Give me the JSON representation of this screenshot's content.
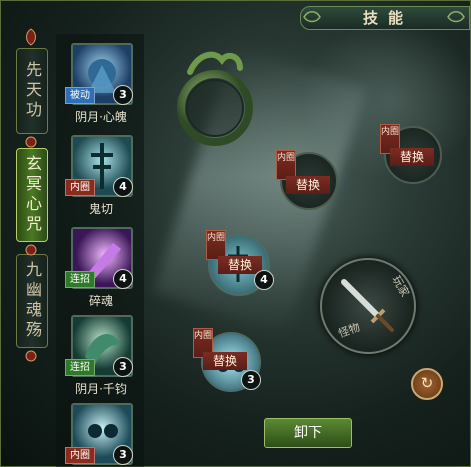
{
  "panel": {
    "title": "技能"
  },
  "tabs": [
    {
      "label": "先天功",
      "active": false
    },
    {
      "label": "玄冥心咒",
      "active": true
    },
    {
      "label": "九幽魂殇",
      "active": false
    }
  ],
  "skills": [
    {
      "name": "阴月·心魄",
      "tag": "被动",
      "tag_color": "blue",
      "level": "3",
      "art_color": "#3a7aa8"
    },
    {
      "name": "鬼切",
      "tag": "内圈",
      "tag_color": "red",
      "level": "4",
      "art_color": "#4b8e98"
    },
    {
      "name": "碎魂",
      "tag": "连招",
      "tag_color": "green",
      "level": "4",
      "art_color": "#7b3aa0"
    },
    {
      "name": "阴月·千钧",
      "tag": "连招",
      "tag_color": "green",
      "level": "3",
      "art_color": "#2f7a6e"
    },
    {
      "name": "",
      "tag": "内圈",
      "tag_color": "red",
      "level": "3",
      "art_color": "#3b8aa0"
    }
  ],
  "slots": {
    "slot_a": {
      "tag": "内圈",
      "label": "替换"
    },
    "slot_b": {
      "tag": "内圈",
      "label": "替换"
    },
    "slot_c": {
      "tag": "内圈",
      "label": "替换",
      "level": "4"
    },
    "slot_d": {
      "tag": "内圈",
      "label": "替换",
      "level": "3"
    },
    "weapon": {
      "left_text": "怪物",
      "right_text": "玩家"
    }
  },
  "buttons": {
    "unload": "卸下"
  },
  "icons": {
    "refresh": "refresh-icon",
    "sword": "sword-icon",
    "jade_ring": "ring-ornament-icon",
    "tab_ornament": "tab-ornament-icon"
  },
  "colors": {
    "accent_green": "#4a7a22",
    "tag_red": "#7c2c22",
    "tag_blue": "#2e6fb5",
    "tag_green": "#2f7a2a",
    "text_cream": "#eadfbf"
  }
}
